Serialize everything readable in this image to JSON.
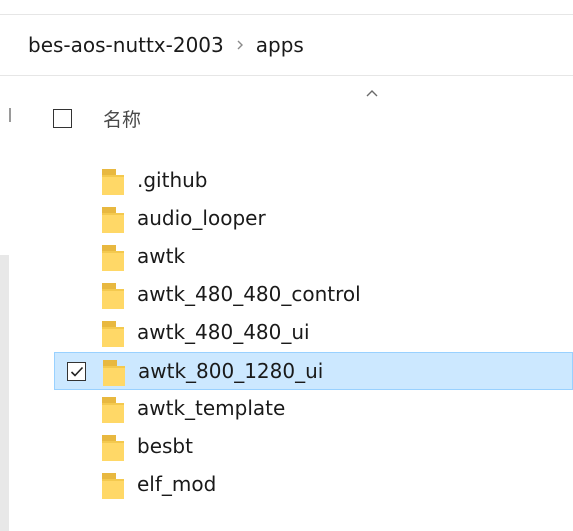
{
  "breadcrumb": {
    "items": [
      "bes-aos-nuttx-2003",
      "apps"
    ]
  },
  "header": {
    "name_label": "名称",
    "sort_icon": "chevron-up-icon"
  },
  "files": [
    {
      "name": ".github",
      "selected": false
    },
    {
      "name": "audio_looper",
      "selected": false
    },
    {
      "name": "awtk",
      "selected": false
    },
    {
      "name": "awtk_480_480_control",
      "selected": false
    },
    {
      "name": "awtk_480_480_ui",
      "selected": false
    },
    {
      "name": "awtk_800_1280_ui",
      "selected": true
    },
    {
      "name": "awtk_template",
      "selected": false
    },
    {
      "name": "besbt",
      "selected": false
    },
    {
      "name": "elf_mod",
      "selected": false
    }
  ],
  "colors": {
    "selection_bg": "#cce8ff",
    "selection_border": "#99d1ff",
    "folder_fill": "#ffd867",
    "folder_tab": "#e8b840"
  }
}
